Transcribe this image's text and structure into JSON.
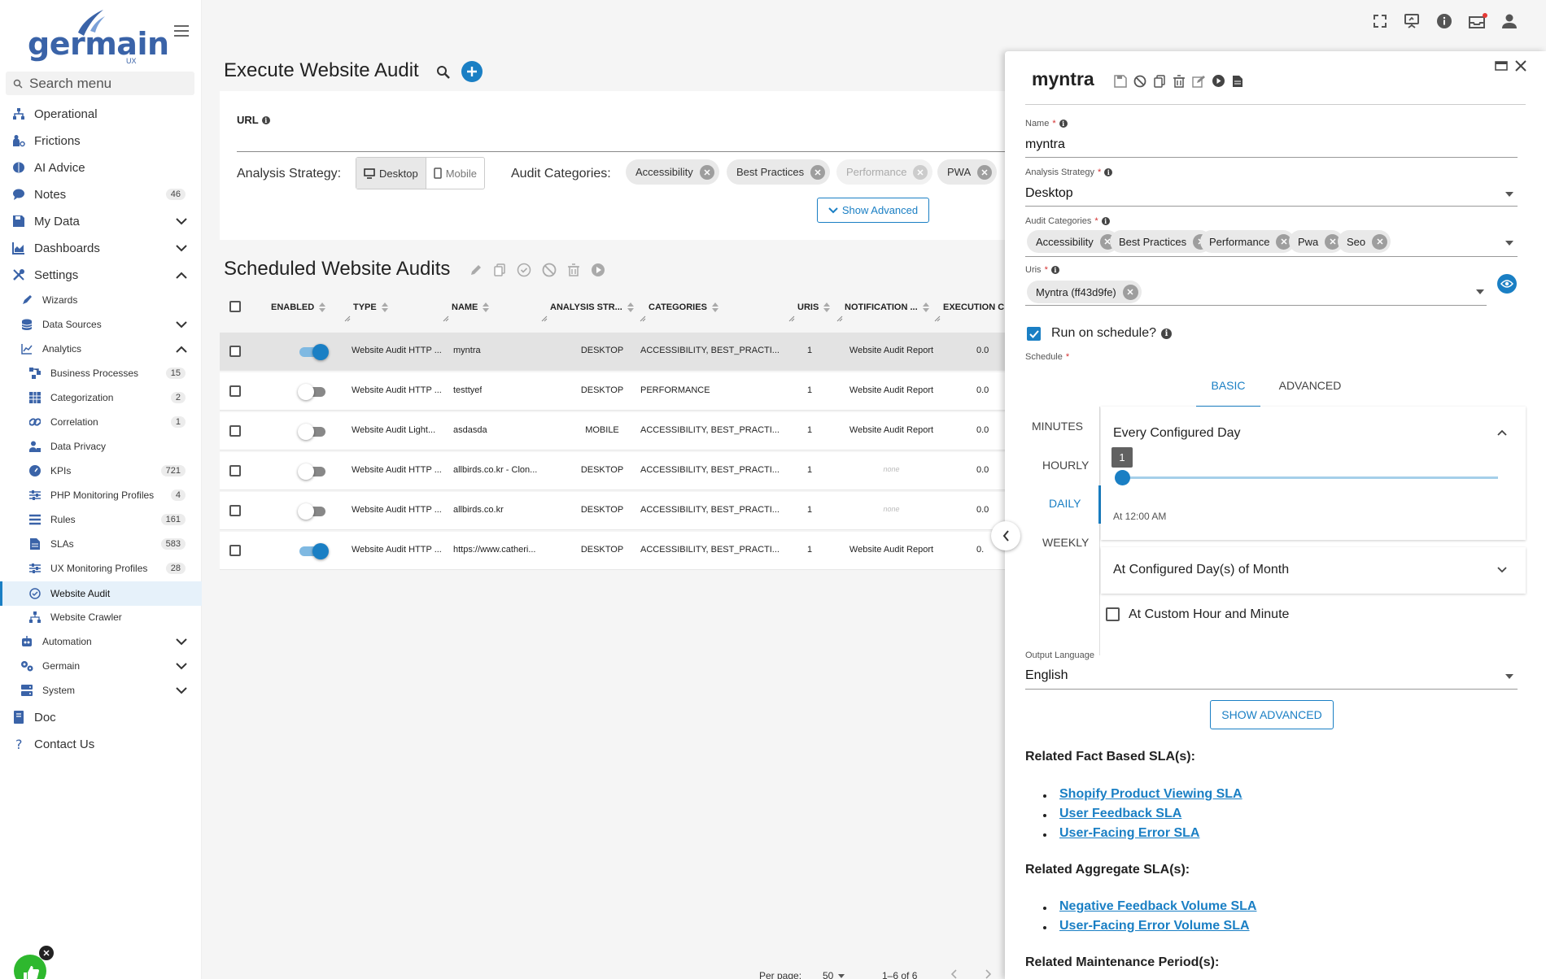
{
  "brand": {
    "logo_text": "germain",
    "logo_sub": "UX"
  },
  "search": {
    "placeholder": "Search menu"
  },
  "nav": {
    "operational": "Operational",
    "frictions": "Frictions",
    "ai_advice": "AI Advice",
    "notes": "Notes",
    "notes_count": "46",
    "my_data": "My Data",
    "dashboards": "Dashboards",
    "settings": "Settings",
    "wizards": "Wizards",
    "data_sources": "Data Sources",
    "analytics": "Analytics",
    "business_processes": "Business Processes",
    "business_processes_count": "15",
    "categorization": "Categorization",
    "categorization_count": "2",
    "correlation": "Correlation",
    "correlation_count": "1",
    "data_privacy": "Data Privacy",
    "kpis": "KPIs",
    "kpis_count": "721",
    "php_monitoring": "PHP Monitoring Profiles",
    "php_monitoring_count": "4",
    "rules": "Rules",
    "rules_count": "161",
    "slas": "SLAs",
    "slas_count": "583",
    "ux_monitoring": "UX Monitoring Profiles",
    "ux_monitoring_count": "28",
    "website_audit": "Website Audit",
    "website_crawler": "Website Crawler",
    "automation": "Automation",
    "germain": "Germain",
    "system": "System",
    "doc": "Doc",
    "contact": "Contact Us"
  },
  "execute": {
    "title": "Execute Website Audit",
    "url_label": "URL",
    "strategy_label": "Analysis Strategy:",
    "strategy_desktop": "Desktop",
    "strategy_mobile": "Mobile",
    "categories_label": "Audit Categories:",
    "categories": [
      "Accessibility",
      "Best Practices",
      "Performance",
      "PWA"
    ],
    "show_advanced": "Show Advanced"
  },
  "scheduled": {
    "title": "Scheduled Website Audits",
    "columns": [
      "ENABLED",
      "TYPE",
      "NAME",
      "ANALYSIS STR...",
      "CATEGORIES",
      "URIS",
      "NOTIFICATION ...",
      "EXECUTION C"
    ],
    "rows": [
      {
        "enabled": true,
        "type": "Website Audit HTTP ...",
        "name": "myntra",
        "strategy": "DESKTOP",
        "categories": "ACCESSIBILITY, BEST_PRACTI...",
        "uris": "1",
        "notification": "Website Audit Report",
        "execution": "0.0"
      },
      {
        "enabled": false,
        "type": "Website Audit HTTP ...",
        "name": "testtyef",
        "strategy": "DESKTOP",
        "categories": "PERFORMANCE",
        "uris": "1",
        "notification": "Website Audit Report",
        "execution": "0.0"
      },
      {
        "enabled": false,
        "type": "Website Audit Light...",
        "name": "asdasda",
        "strategy": "MOBILE",
        "categories": "ACCESSIBILITY, BEST_PRACTI...",
        "uris": "1",
        "notification": "Website Audit Report",
        "execution": "0.0"
      },
      {
        "enabled": false,
        "type": "Website Audit HTTP ...",
        "name": "allbirds.co.kr - Clon...",
        "strategy": "DESKTOP",
        "categories": "ACCESSIBILITY, BEST_PRACTI...",
        "uris": "1",
        "notification": "none",
        "execution": "0.0"
      },
      {
        "enabled": false,
        "type": "Website Audit HTTP ...",
        "name": "allbirds.co.kr",
        "strategy": "DESKTOP",
        "categories": "ACCESSIBILITY, BEST_PRACTI...",
        "uris": "1",
        "notification": "none",
        "execution": "0.0"
      },
      {
        "enabled": true,
        "type": "Website Audit HTTP ...",
        "name": "https://www.catheri...",
        "strategy": "DESKTOP",
        "categories": "ACCESSIBILITY, BEST_PRACTI...",
        "uris": "1",
        "notification": "Website Audit Report",
        "execution": "0."
      }
    ],
    "per_page_label": "Per page:",
    "per_page_value": "50",
    "range": "1–6 of 6"
  },
  "drawer": {
    "title": "myntra",
    "name_label": "Name",
    "name_value": "myntra",
    "strategy_label": "Analysis Strategy",
    "strategy_value": "Desktop",
    "categories_label": "Audit Categories",
    "categories": [
      "Accessibility",
      "Best Practices",
      "Performance",
      "Pwa",
      "Seo"
    ],
    "uris_label": "Uris",
    "uris": [
      "Myntra (ff43d9fe)"
    ],
    "run_on_schedule": "Run on schedule?",
    "schedule_label": "Schedule",
    "tab_basic": "BASIC",
    "tab_advanced": "ADVANCED",
    "freq_minutes": "MINUTES",
    "freq_hourly": "HOURLY",
    "freq_daily": "DAILY",
    "freq_weekly": "WEEKLY",
    "every_configured_day": "Every Configured Day",
    "slider_value": "1",
    "slider_fraction": 0.0,
    "at_time": "At 12:00 AM",
    "configured_days_month": "At Configured Day(s) of Month",
    "custom_hour": "At Custom Hour and Minute",
    "output_language_label": "Output Language",
    "output_language_value": "English",
    "show_advanced": "SHOW ADVANCED",
    "fact_sla_title": "Related Fact Based SLA(s):",
    "fact_slas": [
      "Shopify Product Viewing SLA",
      "User Feedback SLA",
      "User-Facing Error SLA"
    ],
    "aggregate_sla_title": "Related Aggregate SLA(s):",
    "aggregate_slas": [
      "Negative Feedback Volume SLA",
      "User-Facing Error Volume SLA"
    ],
    "maintenance_title": "Related Maintenance Period(s):"
  },
  "colors": {
    "accent": "#1a7fc4",
    "brand": "#3a63a8",
    "notification_dot": "#e53935",
    "feedback_green": "#2eb82e"
  }
}
